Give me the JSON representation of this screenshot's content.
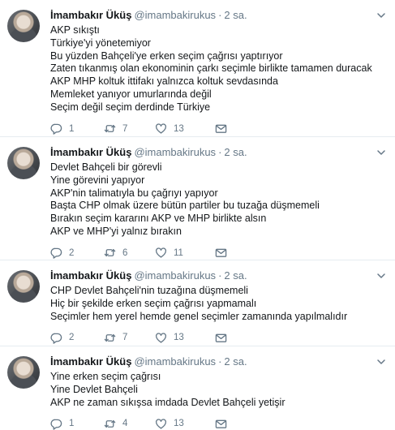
{
  "tweets": [
    {
      "name": "İmambakır Üküş",
      "handle": "@imambakirukus",
      "dot": "·",
      "time": "2 sa.",
      "lines": [
        "AKP sıkıştı",
        "Türkiye'yi yönetemiyor",
        "Bu yüzden  Bahçeli'ye erken seçim çağrısı yaptırıyor",
        "Zaten tıkanmış olan ekonominin çarkı seçimle birlikte tamamen duracak",
        "AKP MHP koltuk ittifakı yalnızca koltuk sevdasında",
        "Memleket yanıyor umurlarında değil",
        "Seçim değil seçim derdinde Türkiye"
      ],
      "replies": "1",
      "retweets": "7",
      "likes": "13"
    },
    {
      "name": "İmambakır Üküş",
      "handle": "@imambakirukus",
      "dot": "·",
      "time": "2 sa.",
      "lines": [
        "Devlet Bahçeli bir görevli",
        "Yine görevini yapıyor",
        "AKP'nin talimatıyla bu çağrıyı yapıyor",
        "Başta CHP olmak üzere bütün partiler bu tuzağa düşmemeli",
        "Bırakın seçim kararını AKP ve MHP birlikte alsın",
        "AKP ve MHP'yi yalnız bırakın"
      ],
      "replies": "2",
      "retweets": "6",
      "likes": "11"
    },
    {
      "name": "İmambakır Üküş",
      "handle": "@imambakirukus",
      "dot": "·",
      "time": "2 sa.",
      "lines": [
        "CHP Devlet Bahçeli'nin tuzağına düşmemeli",
        "Hiç bir şekilde erken seçim çağrısı yapmamalı",
        "Seçimler hem yerel hemde genel seçimler zamanında yapılmalıdır"
      ],
      "replies": "2",
      "retweets": "7",
      "likes": "13"
    },
    {
      "name": "İmambakır Üküş",
      "handle": "@imambakirukus",
      "dot": "·",
      "time": "2 sa.",
      "lines": [
        "Yine erken seçim çağrısı",
        "Yine Devlet Bahçeli",
        "AKP ne zaman sıkışsa imdada Devlet Bahçeli yetişir"
      ],
      "replies": "1",
      "retweets": "4",
      "likes": "13"
    }
  ]
}
